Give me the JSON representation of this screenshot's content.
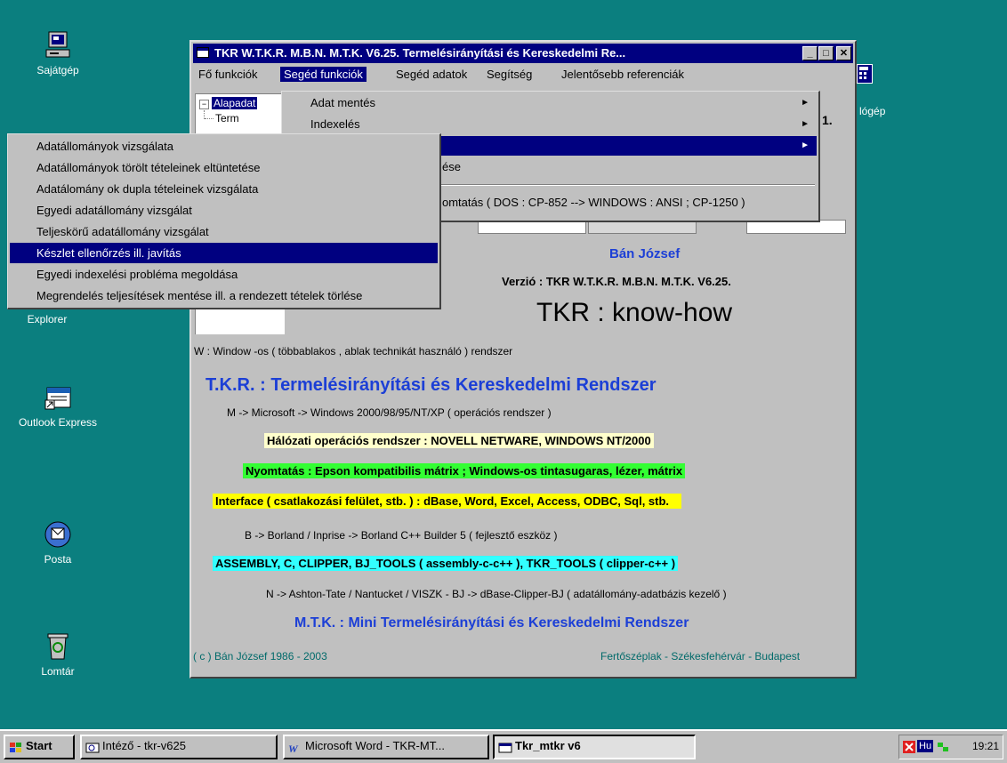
{
  "desktop": {
    "icons": [
      {
        "name": "my-computer-icon",
        "label": "Sajátgép"
      },
      {
        "name": "explorer-icon",
        "label": "Explorer"
      },
      {
        "name": "outlook-express-icon",
        "label": "Outlook Express"
      },
      {
        "name": "posta-icon",
        "label": "Posta"
      },
      {
        "name": "recycle-bin-icon",
        "label": "Lomtár"
      }
    ],
    "right_icon_label": "lógép"
  },
  "window": {
    "title": "TKR W.T.K.R. M.B.N. M.T.K. V6.25. Termelésirányítási és Kereskedelmi Re...",
    "buttons": {
      "minimize": "_",
      "maximize": "□",
      "close": "✕"
    }
  },
  "menubar": {
    "items": [
      "Fő funkciók",
      "Segéd funkciók",
      "Segéd adatok",
      "Segítség",
      "Jelentősebb referenciák"
    ]
  },
  "tree": {
    "items": [
      "Alapadat",
      "Term"
    ]
  },
  "dropdown": {
    "items": [
      {
        "label": "Adat mentés",
        "has_submenu": true
      },
      {
        "label": "Indexelés",
        "has_submenu": true
      },
      {
        "label": "",
        "has_submenu": true
      },
      {
        "label": "ése",
        "has_submenu": false
      },
      {
        "label": "omtatás  ( DOS : CP-852 --> WINDOWS : ANSI ; CP-1250 )",
        "has_submenu": false
      }
    ],
    "arrow": "►",
    "peek_text": "1."
  },
  "submenu": {
    "items": [
      "Adatállományok vizsgálata",
      "Adatállományok törölt tételeinek eltüntetése",
      "Adatálomány ok dupla tételeinek vizsgálata",
      "Egyedi adatállomány vizsgálat",
      "Teljeskörű adatállomány vizsgálat",
      "Készlet ellenőrzés ill. javítás",
      "Egyedi indexelési probléma megoldása",
      "Megrendelés teljesítések mentése ill. a rendezett tételek törlése"
    ],
    "selected_index": 5
  },
  "content": {
    "author": "Bán József",
    "version": "Verzió : TKR W.T.K.R. M.B.N. M.T.K. V6.25.",
    "knowhow": "TKR :  know-how",
    "w_line": "W : Window -os ( többablakos , ablak technikát használó ) rendszer",
    "tkr_title": "T.K.R. : Termelésirányítási és Kereskedelmi Rendszer",
    "m_line": "M -> Microsoft -> Windows 2000/98/95/NT/XP       ( operációs rendszer )",
    "network": "Hálózati operációs rendszer : NOVELL NETWARE, WINDOWS NT/2000",
    "printing": "Nyomtatás : Epson kompatibilis mátrix ;  Windows-os tintasugaras, lézer, mátrix",
    "interface": "Interface ( csatlakozási felület, stb. )  : dBase, Word, Excel, Access, ODBC, Sql, stb.",
    "b_line": "B -> Borland / Inprise -> Borland C++ Builder 5      ( fejlesztő eszköz )",
    "assembly": "ASSEMBLY, C, CLIPPER, BJ_TOOLS ( assembly-c-c++ ), TKR_TOOLS ( clipper-c++ )",
    "n_line": "N -> Ashton-Tate / Nantucket / VISZK - BJ -> dBase-Clipper-BJ   ( adatállomány-adatbázis kezelő )",
    "mtk_title": "M.T.K.  : Mini Termelésirányítási és Kereskedelmi Rendszer",
    "copyright": "( c ) Bán József 1986 - 2003",
    "location": "Fertőszéplak - Székesfehérvár - Budapest"
  },
  "colors": {
    "desktop": "#0b7f7f",
    "title_bar": "#000080",
    "blue_text": "#1c3fd6",
    "network_bg": "#ffffcc",
    "printing_bg": "#33ff33",
    "interface_bg": "#ffff00",
    "assembly_bg": "#33ffff",
    "footer_text": "#006a6a"
  },
  "taskbar": {
    "start": "Start",
    "tasks": [
      "Intéző - tkr-v625",
      "Microsoft Word - TKR-MT...",
      "Tkr_mtkr v6"
    ],
    "tray": {
      "lang": "Hu",
      "time": "19:21"
    }
  }
}
